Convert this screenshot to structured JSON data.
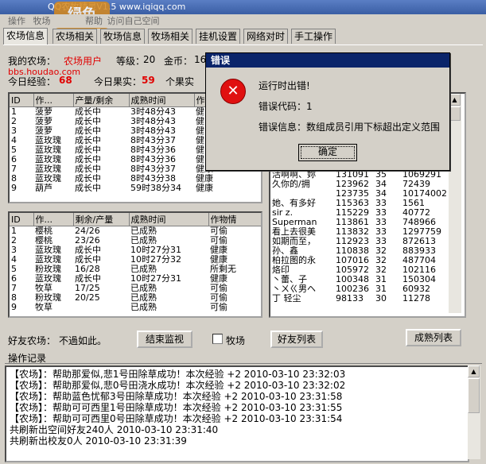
{
  "window": {
    "title": "QQ农牧精灵V1.5 www.iqiqq.com",
    "menu": [
      "操作",
      "牧场",
      "帮助",
      "访问自己空间"
    ],
    "watermark": "绿色"
  },
  "tabs": [
    "农场信息",
    "农场相关",
    "牧场信息",
    "牧场相关",
    "挂机设置",
    "网络对时",
    "手工操作"
  ],
  "info": {
    "my_farm_label": "我的农场：",
    "my_farm_value": "农场用户",
    "level_label": "等级：",
    "level_value": "20",
    "gold_label": "金币：",
    "gold_value": "16",
    "today_exp_label": "今日经验：",
    "today_exp_value": "68",
    "today_fruit_label": "今日果实：",
    "today_fruit_value": "59",
    "fruit_suffix": "个果实",
    "site_watermark": "bbs.houdao.com"
  },
  "crop_table": {
    "headers": [
      "ID",
      "作...",
      "产量/剩余",
      "成熟时间",
      "作"
    ],
    "rows": [
      [
        "1",
        "菠萝",
        "成长中",
        "3时48分43",
        "健"
      ],
      [
        "2",
        "菠萝",
        "成长中",
        "3时48分43",
        "健"
      ],
      [
        "3",
        "菠萝",
        "成长中",
        "3时48分43",
        "健"
      ],
      [
        "4",
        "蓝玫瑰",
        "成长中",
        "8时43分37",
        "健"
      ],
      [
        "5",
        "蓝玫瑰",
        "成长中",
        "8时43分36",
        "健"
      ],
      [
        "6",
        "蓝玫瑰",
        "成长中",
        "8时43分36",
        "健"
      ],
      [
        "7",
        "蓝玫瑰",
        "成长中",
        "8时43分37",
        "健康"
      ],
      [
        "8",
        "蓝玫瑰",
        "成长中",
        "8时43分38",
        "健康"
      ],
      [
        "9",
        "葫芦",
        "成长中",
        "59时38分34",
        "健康"
      ]
    ]
  },
  "friend_crop_table": {
    "headers": [
      "ID",
      "作...",
      "剩余/产量",
      "成熟时间",
      "作物情"
    ],
    "rows": [
      [
        "1",
        "樱桃",
        "24/26",
        "已成熟",
        "可偷"
      ],
      [
        "2",
        "樱桃",
        "23/26",
        "已成熟",
        "可偷"
      ],
      [
        "3",
        "蓝玫瑰",
        "成长中",
        "10时27分31",
        "健康"
      ],
      [
        "4",
        "蓝玫瑰",
        "成长中",
        "10时27分32",
        "健康"
      ],
      [
        "5",
        "粉玫瑰",
        "16/28",
        "已成熟",
        "所剩无"
      ],
      [
        "6",
        "蓝玫瑰",
        "成长中",
        "10时27分31",
        "健康"
      ],
      [
        "7",
        "牧草",
        "17/25",
        "已成熟",
        "可偷"
      ],
      [
        "8",
        "粉玫瑰",
        "20/25",
        "已成熟",
        "可偷"
      ],
      [
        "9",
        "牧草",
        "",
        "已成熟",
        "可偷"
      ]
    ]
  },
  "friend_list": {
    "rows": [
      [
        "活啊啊、妳",
        "131091",
        "35",
        "1069291"
      ],
      [
        "久你的/拥",
        "123962",
        "34",
        "72439"
      ],
      [
        "",
        "123735",
        "34",
        "10174002"
      ],
      [
        "她、有多好",
        "115363",
        "33",
        "1561"
      ],
      [
        "sir z.",
        "115229",
        "33",
        "40772"
      ],
      [
        "Superman",
        "113861",
        "33",
        "748966"
      ],
      [
        "看上去很美",
        "113832",
        "33",
        "1297759"
      ],
      [
        "如期而至，",
        "112923",
        "33",
        "872613"
      ],
      [
        "孙、鑫",
        "110838",
        "32",
        "883933"
      ],
      [
        "柏拉图的永",
        "107016",
        "32",
        "487704"
      ],
      [
        "烙印",
        "105972",
        "32",
        "102116"
      ],
      [
        "丶蕾、子",
        "100348",
        "31",
        "150304"
      ],
      [
        "丶ㄨㄍ男ヘ",
        "100236",
        "31",
        "60932"
      ],
      [
        "丁 轻尘",
        "98133",
        "30",
        "11278"
      ]
    ]
  },
  "controls": {
    "friend_farm_label": "好友农场：",
    "friend_farm_value": "不過如此。",
    "end_monitor": "结束监视",
    "pasture_checkbox": "牧场",
    "friend_list_btn": "好友列表",
    "mature_list_btn": "成熟列表"
  },
  "log": {
    "title": "操作记录",
    "lines": [
      "【农场】：帮助那爱似,悲1号田除草成功！本次经验 +2              2010-03-10  23:32:03",
      "【农场】：帮助那爱似,悲0号田浇水成功！本次经验 +2              2010-03-10  23:32:02",
      "【农场】：帮助蓝色忧郁3号田除草成功！本次经验 +2            2010-03-10  23:31:58",
      "【农场】：帮助可可西里1号田除草成功！本次经验 +2            2010-03-10  23:31:55",
      "【农场】：帮助可可西里0号田除草成功！本次经验 +2            2010-03-10  23:31:54",
      "共刷新出空间好友240人          2010-03-10  23:31:40",
      "共刷新出校友0人          2010-03-10  23:31:39"
    ]
  },
  "dialog": {
    "title": "错误",
    "line1": "运行时出错!",
    "line2": "错误代码：1",
    "line3": "错误信息：数组成员引用下标超出定义范围",
    "ok": "确定"
  }
}
